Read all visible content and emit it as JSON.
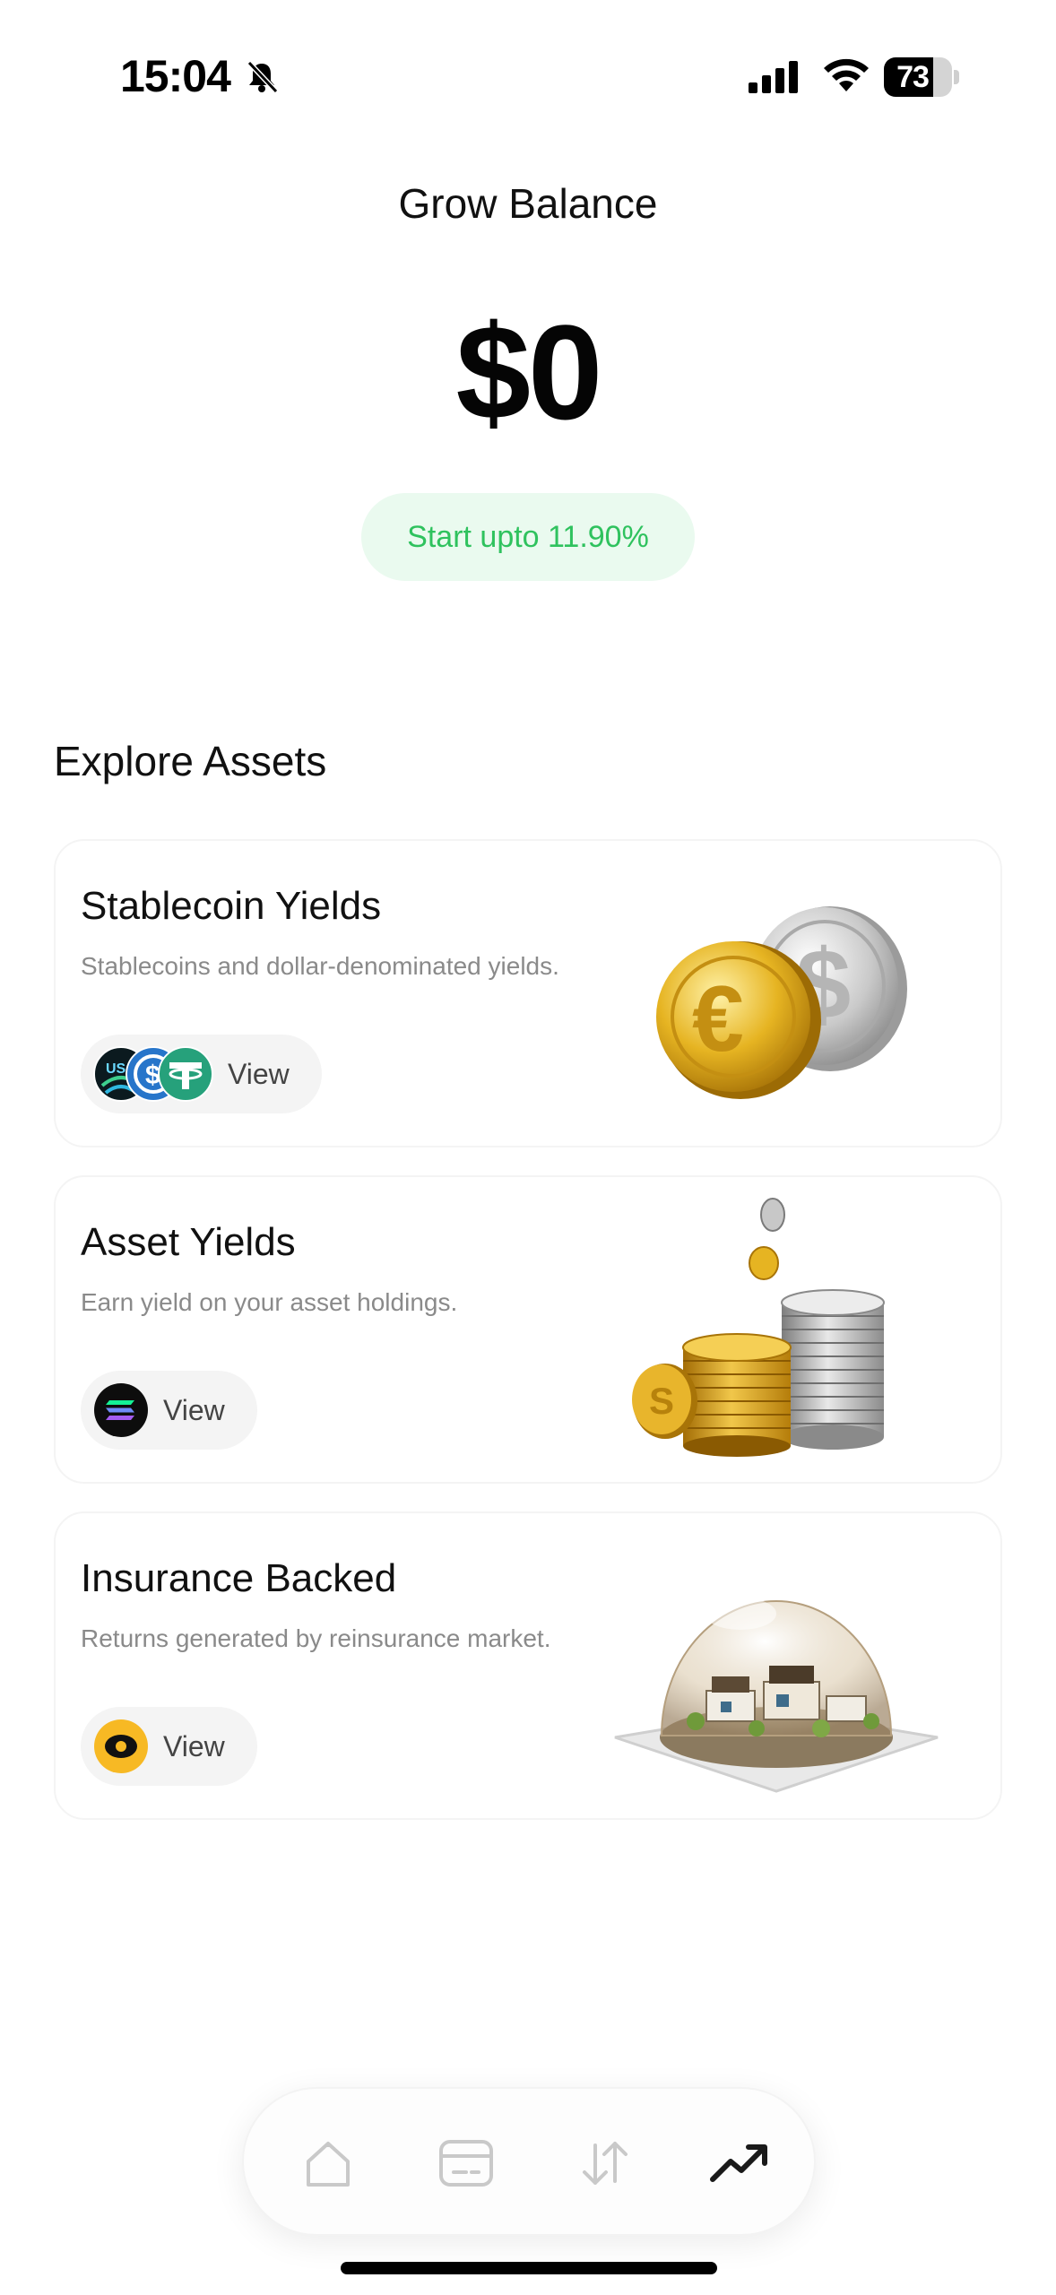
{
  "status_bar": {
    "time": "15:04",
    "battery": "73",
    "battery_level": 0.73
  },
  "header": {
    "title": "Grow Balance",
    "balance": "$0",
    "apy_badge": "Start upto 11.90%"
  },
  "explore": {
    "title": "Explore Assets",
    "cards": [
      {
        "title": "Stablecoin Yields",
        "description": "Stablecoins and dollar-denominated yields.",
        "button": "View",
        "icons": [
          "usds-icon",
          "usdc-icon",
          "tether-icon"
        ],
        "art": "gold-and-silver-coins"
      },
      {
        "title": "Asset Yields",
        "description": "Earn yield on your asset holdings.",
        "button": "View",
        "icons": [
          "solana-icon"
        ],
        "art": "coin-stacks"
      },
      {
        "title": "Insurance Backed",
        "description": "Returns generated by reinsurance market.",
        "button": "View",
        "icons": [
          "insurance-token-icon"
        ],
        "art": "houses-under-glass-dome"
      }
    ]
  },
  "bottom_nav": {
    "items": [
      "home-icon",
      "card-icon",
      "transfer-icon",
      "trending-up-icon"
    ],
    "active": "trending-up-icon"
  },
  "colors": {
    "accent_green": "#2fc25e",
    "badge_bg": "#eafaef",
    "muted_text": "#8a8a8a",
    "pill_bg": "#f4f4f4"
  }
}
